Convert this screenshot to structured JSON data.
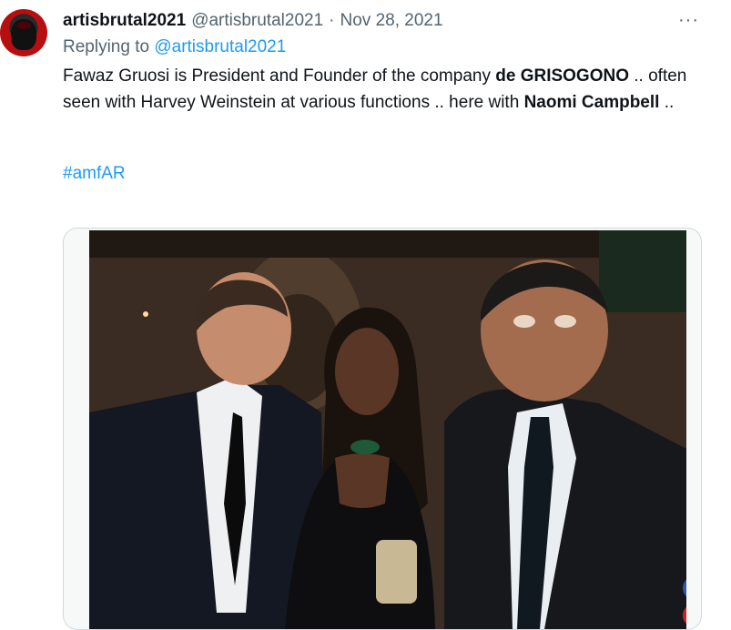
{
  "tweet": {
    "display_name": "artisbrutal2021",
    "handle": "@artisbrutal2021",
    "separator": "·",
    "date": "Nov 28, 2021",
    "more_icon": "ellipsis-icon",
    "more_label": "···",
    "reply_prefix": "Replying to",
    "reply_handle": "@artisbrutal2021",
    "text_1": "Fawaz Gruosi is  President and Founder of the company ",
    "bold_1": "de GRISOGONO",
    "text_2": " .. often seen with Harvey Weinstein at various functions .. here with ",
    "bold_2": "Naomi Campbell",
    "text_3": " ..",
    "hashtag": "#amfAR"
  },
  "media": {
    "image_alt": "photo",
    "share_facebook": "f",
    "share_pinterest": "P",
    "colors": {
      "facebook": "#2d5aa8",
      "pinterest": "#c8232c",
      "link": "#1d9bf0"
    }
  }
}
